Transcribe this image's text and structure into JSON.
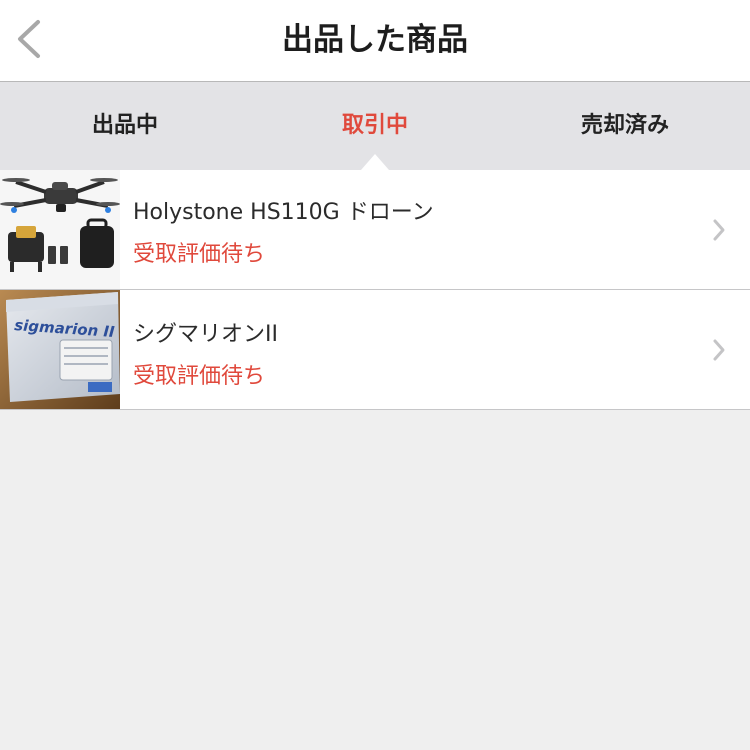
{
  "header": {
    "title": "出品した商品",
    "back_icon": "chevron-left-icon"
  },
  "tabs": [
    {
      "label": "出品中",
      "active": false
    },
    {
      "label": "取引中",
      "active": true
    },
    {
      "label": "売却済み",
      "active": false
    }
  ],
  "items": [
    {
      "title": "Holystone HS110G ドローン",
      "status": "受取評価待ち",
      "thumbnail": "drone-product-photo"
    },
    {
      "title": "シグマリオンII",
      "status": "受取評価待ち",
      "thumbnail": "sigmarion-box-photo",
      "thumbnail_text": "sigmarion II"
    }
  ],
  "colors": {
    "accent": "#e0493c",
    "tab_bar": "#e3e3e6",
    "background": "#efefef"
  }
}
